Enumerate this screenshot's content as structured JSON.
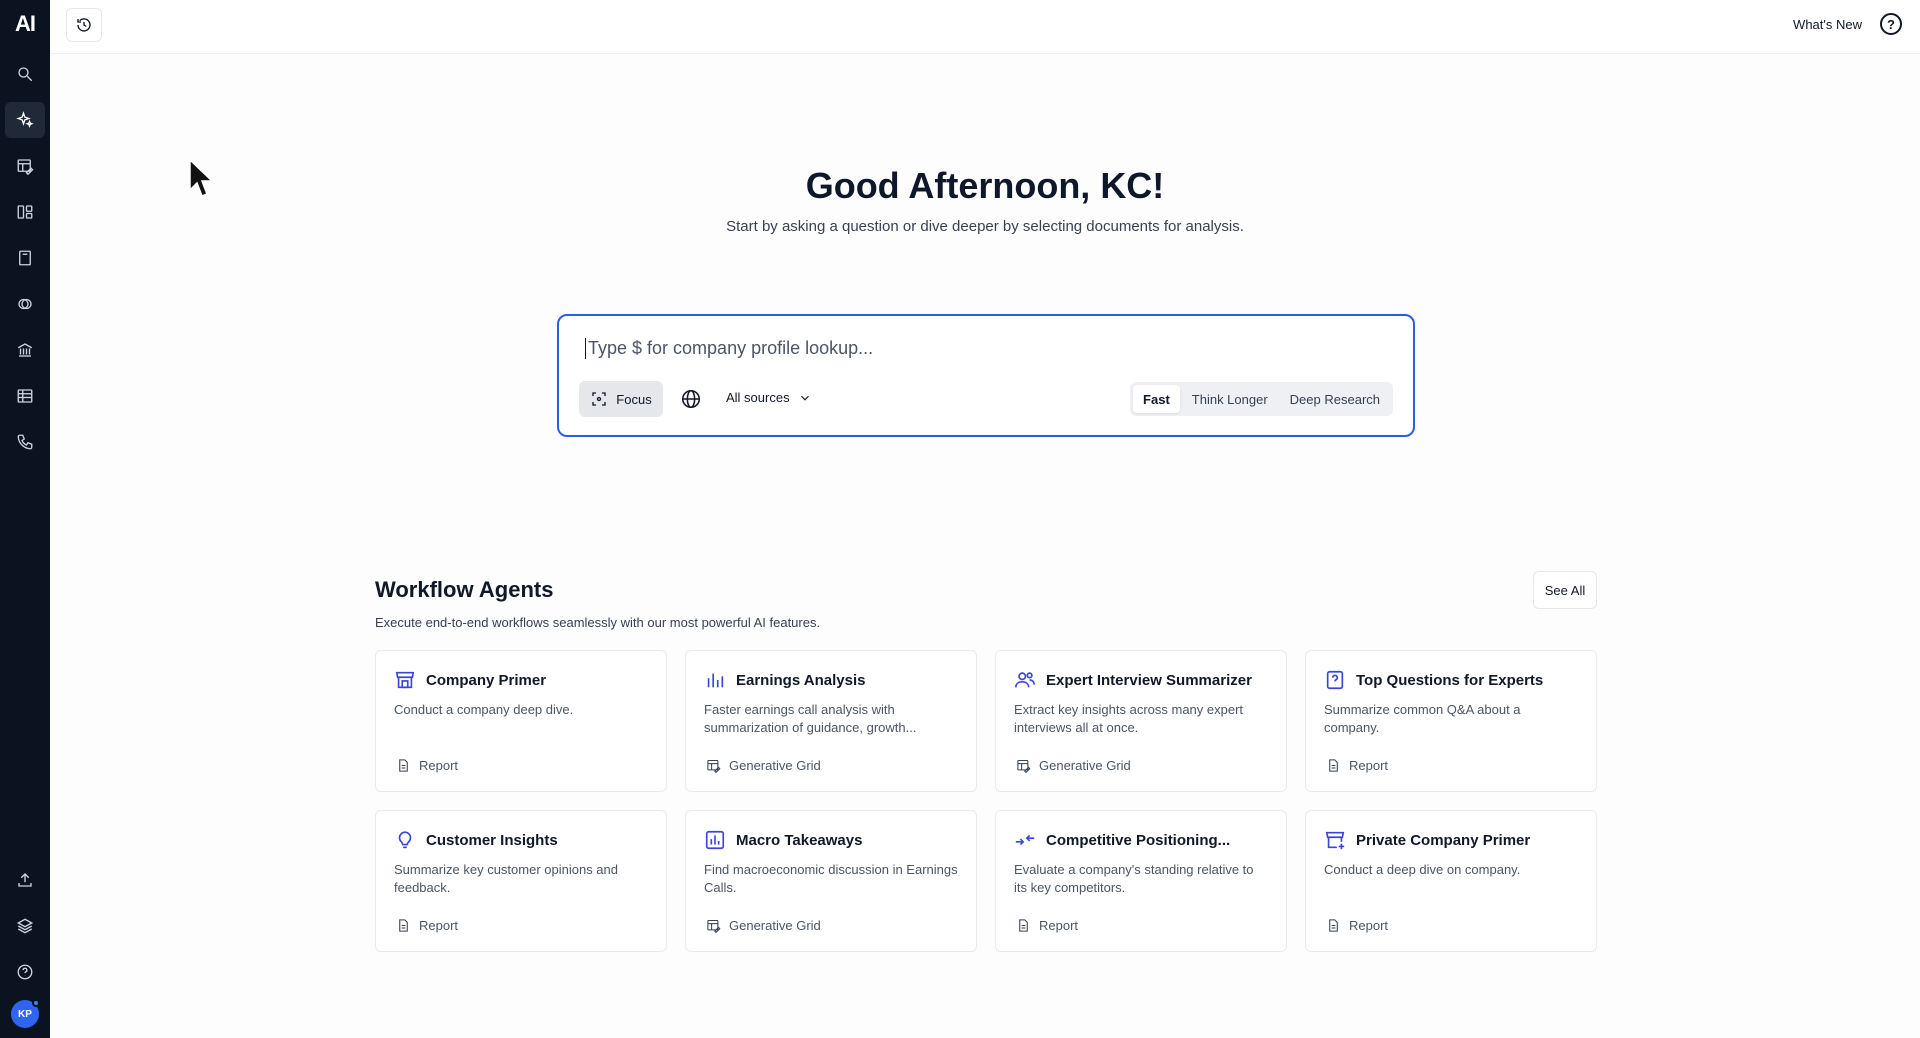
{
  "sidebar": {
    "logo": "AI",
    "items": [
      {
        "icon": "search-icon"
      },
      {
        "icon": "sparkles-icon",
        "active": true
      },
      {
        "icon": "grid-edit-icon"
      },
      {
        "icon": "layout-icon"
      },
      {
        "icon": "notebook-icon"
      },
      {
        "icon": "overlap-circles-icon"
      },
      {
        "icon": "bank-icon"
      },
      {
        "icon": "table-icon"
      },
      {
        "icon": "phone-icon"
      }
    ],
    "bottom_items": [
      {
        "icon": "upload-icon"
      },
      {
        "icon": "layers-icon"
      },
      {
        "icon": "help-icon"
      }
    ],
    "avatar_initials": "KP"
  },
  "topbar": {
    "whats_new": "What's New",
    "help_glyph": "?"
  },
  "main": {
    "greeting": "Good Afternoon, KC!",
    "subtitle": "Start by asking a question or dive deeper by selecting documents for analysis."
  },
  "search": {
    "placeholder": "Type $ for company profile lookup...",
    "focus_label": "Focus",
    "sources_label": "All sources",
    "modes": [
      "Fast",
      "Think Longer",
      "Deep Research"
    ],
    "active_mode": "Fast"
  },
  "workflow": {
    "title": "Workflow Agents",
    "subtitle": "Execute end-to-end workflows seamlessly with our most powerful AI features.",
    "see_all": "See All",
    "cards": [
      {
        "title": "Company Primer",
        "desc": "Conduct a company deep dive.",
        "type": "Report",
        "icon": "store-icon",
        "type_icon": "document-icon"
      },
      {
        "title": "Earnings Analysis",
        "desc": "Faster earnings call analysis with summarization of guidance, growth...",
        "type": "Generative Grid",
        "icon": "bar-chart-icon",
        "type_icon": "grid-edit-icon"
      },
      {
        "title": "Expert Interview Summarizer",
        "desc": "Extract key insights across many expert interviews all at once.",
        "type": "Generative Grid",
        "icon": "users-icon",
        "type_icon": "grid-edit-icon"
      },
      {
        "title": "Top Questions for Experts",
        "desc": "Summarize common Q&A about a company.",
        "type": "Report",
        "icon": "question-box-icon",
        "type_icon": "document-icon"
      },
      {
        "title": "Customer Insights",
        "desc": "Summarize key customer opinions and feedback.",
        "type": "Report",
        "icon": "lightbulb-icon",
        "type_icon": "document-icon"
      },
      {
        "title": "Macro Takeaways",
        "desc": "Find macroeconomic discussion in Earnings Calls.",
        "type": "Generative Grid",
        "icon": "chart-box-icon",
        "type_icon": "grid-edit-icon"
      },
      {
        "title": "Competitive Positioning...",
        "desc": "Evaluate a company's standing relative to its key competitors.",
        "type": "Report",
        "icon": "arrows-icon",
        "type_icon": "document-icon"
      },
      {
        "title": "Private Company Primer",
        "desc": "Conduct a deep dive on company.",
        "type": "Report",
        "icon": "store-plus-icon",
        "type_icon": "document-icon"
      }
    ]
  },
  "colors": {
    "sidebar_bg": "#0b1220",
    "accent": "#2f5bea",
    "card_icon": "#3b46d9"
  }
}
